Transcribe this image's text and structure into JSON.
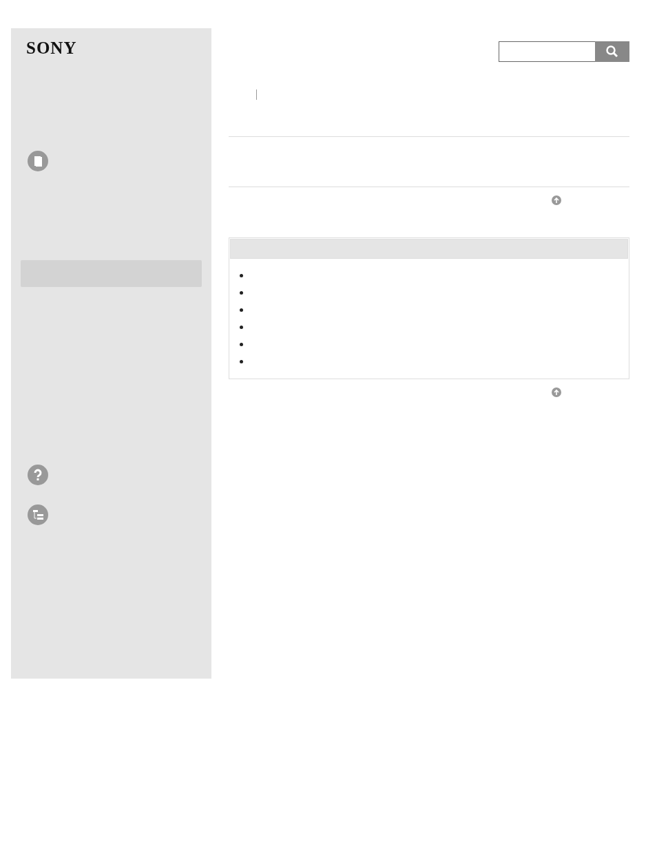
{
  "logo": {
    "text": "SONY"
  },
  "sidebar_items": [
    {
      "kind": "book"
    },
    {
      "kind": "highlight"
    },
    {
      "kind": "help"
    },
    {
      "kind": "tree"
    }
  ],
  "bullets": [
    {
      "kind": "bullet"
    },
    {
      "kind": "bullet"
    },
    {
      "kind": "bullet"
    },
    {
      "kind": "bullet"
    },
    {
      "kind": "bullet"
    },
    {
      "kind": "bullet"
    }
  ]
}
